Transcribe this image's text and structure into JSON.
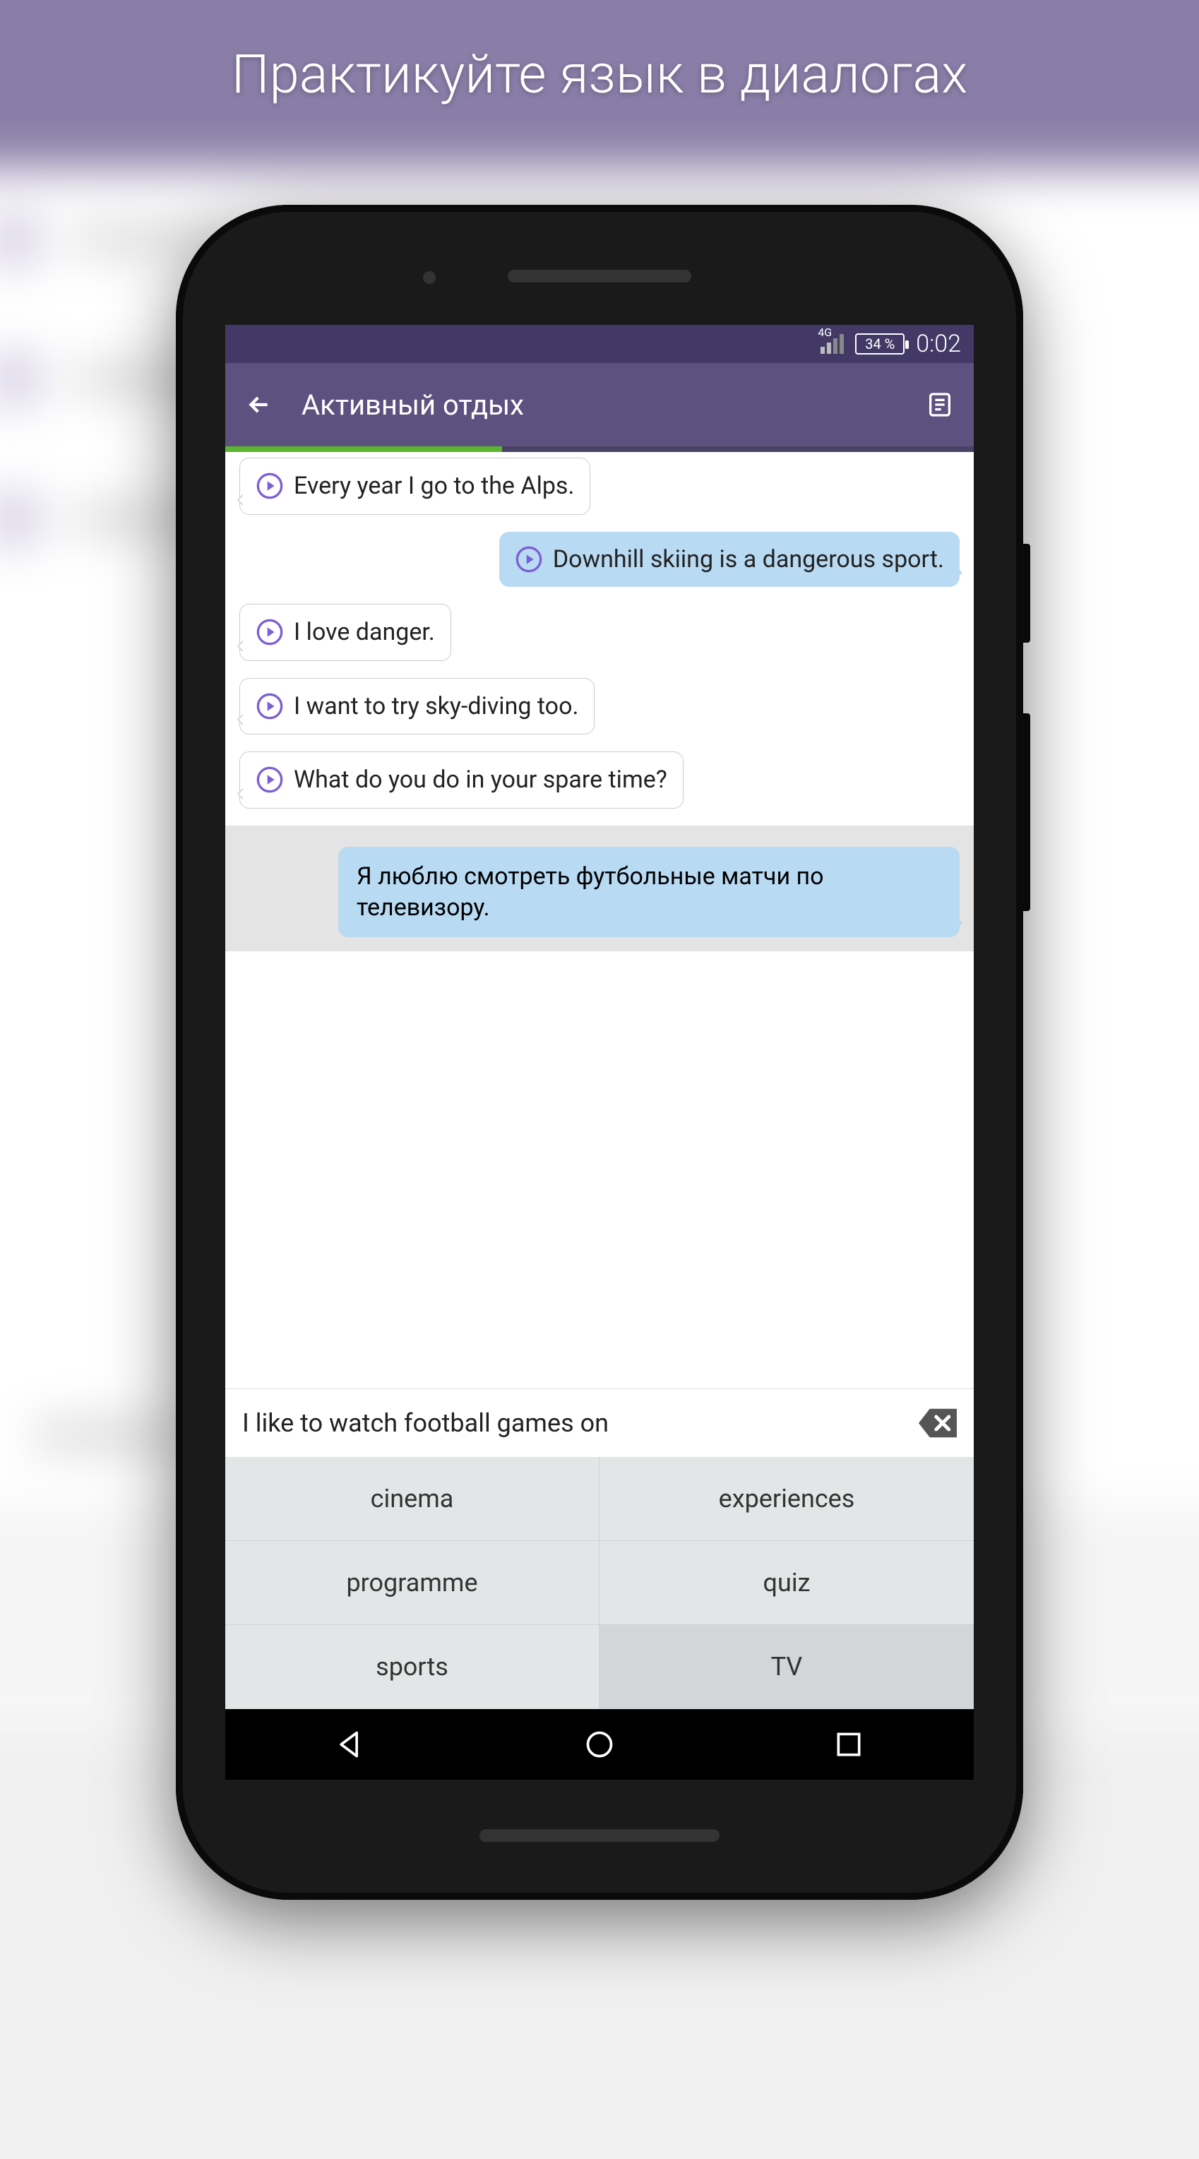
{
  "page_heading": "Практикуйте язык в диалогах",
  "status_bar": {
    "network": "4G",
    "battery": "34 %",
    "time": "0:02"
  },
  "app_bar": {
    "title": "Активный отдых"
  },
  "messages": [
    {
      "side": "left",
      "text": "Every year I go to the Alps."
    },
    {
      "side": "right",
      "text": "Downhill skiing is a dangerous sport."
    },
    {
      "side": "left",
      "text": "I love danger."
    },
    {
      "side": "left",
      "text": "I want to try sky-diving too."
    },
    {
      "side": "left",
      "text": "What do you do in your spare time?"
    }
  ],
  "prompt": "Я люблю смотреть футбольные матчи по телевизору.",
  "input_text": "I like to watch football games on",
  "word_bank": [
    "cinema",
    "experiences",
    "programme",
    "quiz",
    "sports",
    "TV"
  ]
}
